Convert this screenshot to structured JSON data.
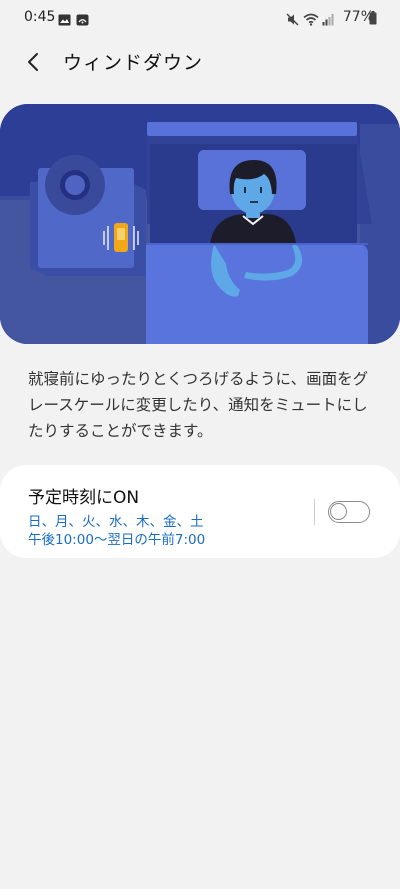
{
  "status_bar": {
    "time": "0:45",
    "battery": "77%",
    "icons": [
      "image-icon",
      "cast-icon",
      "mute-icon",
      "wifi-icon",
      "signal-icon",
      "battery-icon"
    ]
  },
  "header": {
    "back_icon": "back-arrow-icon",
    "title": "ウィンドダウン"
  },
  "illustration": {
    "description_icon": "person-in-bed-illustration",
    "colors": {
      "background": "#2d3e96",
      "floor": "#4a5cb5",
      "bed": "#5872d9",
      "skin": "#5ea8e8",
      "phone": "#f0a818"
    }
  },
  "description": "就寝前にゆったりとくつろげるように、画面をグレースケールに変更したり、通知をミュートにしたりすることができます。",
  "schedule": {
    "title": "予定時刻にON",
    "days": "日、月、火、水、木、金、土",
    "time": "午後10:00～翌日の午前7:00",
    "toggle_on": false,
    "accent_color": "#1a6cc4"
  }
}
